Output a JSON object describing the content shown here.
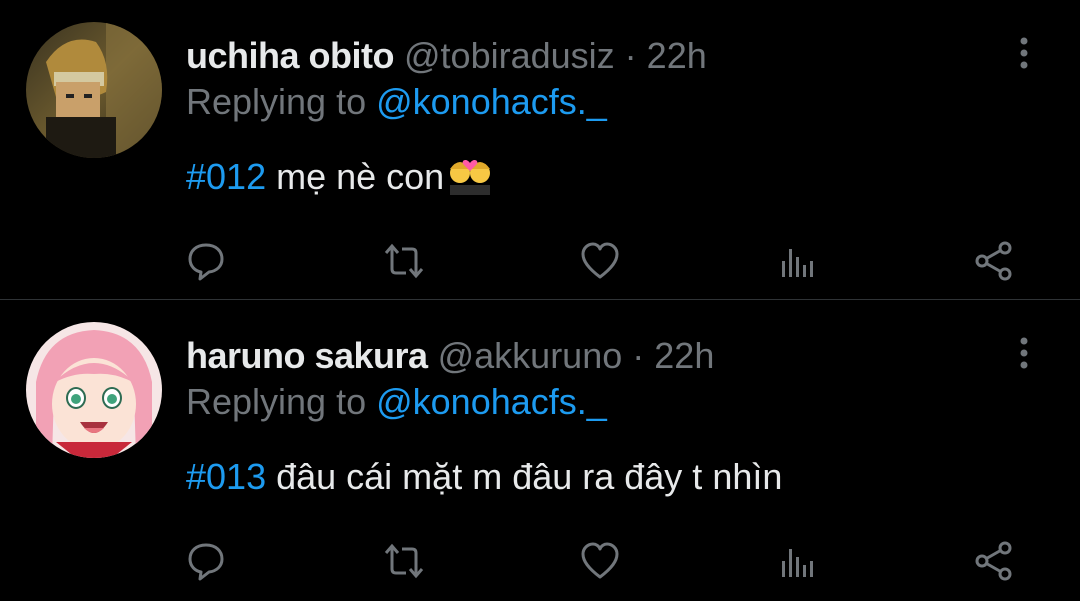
{
  "tweets": [
    {
      "name": "uchiha obito",
      "handle": "@tobiradusiz",
      "separator": "·",
      "time": "22h",
      "replying_prefix": "Replying to ",
      "replying_to": "@konohacfs._",
      "hashtag": "#012",
      "text": " mẹ nè con",
      "emoji": "couple-with-heart-emoji"
    },
    {
      "name": "haruno sakura",
      "handle": "@akkuruno",
      "separator": "·",
      "time": "22h",
      "replying_prefix": "Replying to ",
      "replying_to": "@konohacfs._",
      "hashtag": "#013",
      "text": " đâu cái mặt m đâu ra đây t nhìn"
    }
  ],
  "icons": {
    "reply": "speech-bubble-icon",
    "retweet": "retweet-arrows-icon",
    "like": "heart-outline-icon",
    "views": "bar-chart-icon",
    "share": "share-nodes-icon",
    "more": "vertical-ellipsis-icon"
  },
  "colors": {
    "background": "#000000",
    "primary_text": "#e7e9ea",
    "secondary_text": "#71767b",
    "link": "#1d9bf0",
    "divider": "#2f3336"
  }
}
